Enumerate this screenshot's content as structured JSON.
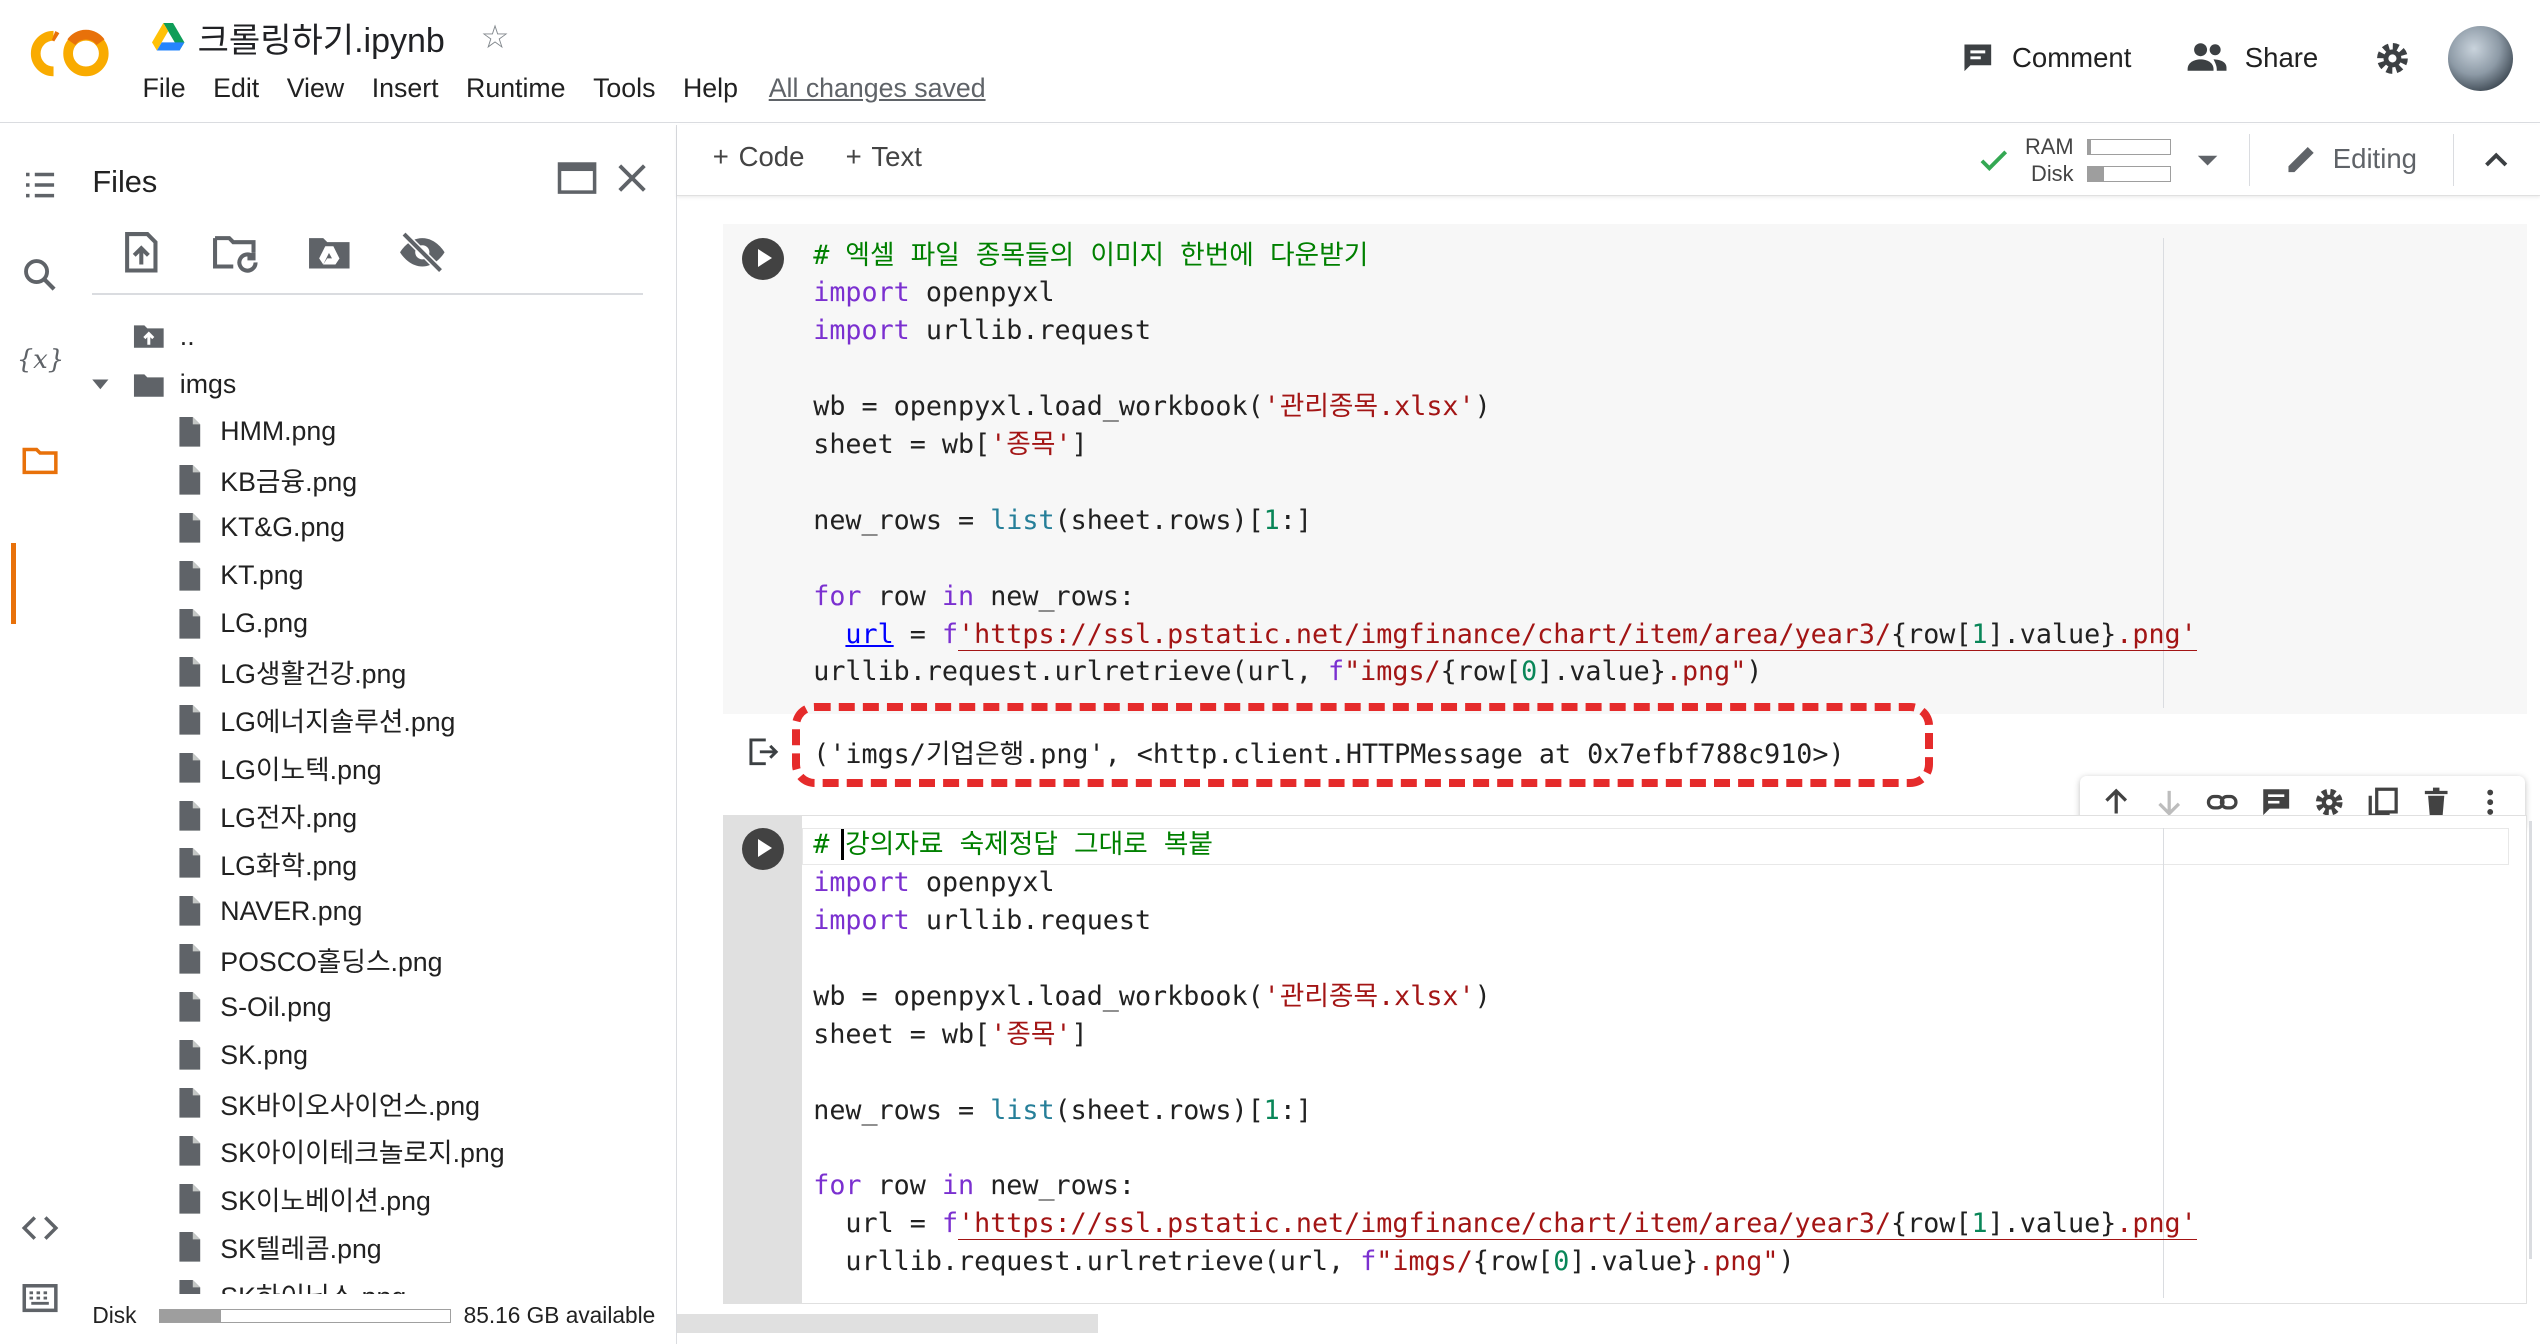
{
  "app": {
    "notebook_title": "크롤링하기.ipynb",
    "menu": [
      "File",
      "Edit",
      "View",
      "Insert",
      "Runtime",
      "Tools",
      "Help"
    ],
    "saved_status": "All changes saved",
    "comment_label": "Comment",
    "share_label": "Share"
  },
  "files_panel": {
    "title": "Files",
    "parent_dir": "..",
    "folder": "imgs",
    "files": [
      "HMM.png",
      "KB금융.png",
      "KT&G.png",
      "KT.png",
      "LG.png",
      "LG생활건강.png",
      "LG에너지솔루션.png",
      "LG이노텍.png",
      "LG전자.png",
      "LG화학.png",
      "NAVER.png",
      "POSCO홀딩스.png",
      "S-Oil.png",
      "SK.png",
      "SK바이오사이언스.png",
      "SK아이이테크놀로지.png",
      "SK이노베이션.png",
      "SK텔레콤.png",
      "SK하이닉스.png"
    ],
    "disk_label": "Disk",
    "disk_available": "85.16 GB available",
    "disk_used_fraction": 0.21
  },
  "toolbar": {
    "add_code": "Code",
    "add_text": "Text",
    "ram_label": "RAM",
    "disk_label": "Disk",
    "ram_used_fraction": 0.04,
    "disk_used_fraction": 0.2,
    "editing_label": "Editing"
  },
  "cell1": {
    "comment": "# 엑셀 파일 종목들의 이미지 한번에 다운받기",
    "output": "('imgs/기업은행.png', <http.client.HTTPMessage at 0x7efbf788c910>)"
  },
  "cell2": {
    "comment_hash": "#",
    "comment_text": "강의자료 숙제정답 그대로 복붙"
  },
  "code_tokens": {
    "import": "import",
    "openpyxl": "openpyxl",
    "urllib_request": "urllib.request",
    "wb_line_a": "wb = openpyxl.load_workbook(",
    "workbook_str": "'관리종목.xlsx'",
    "close_paren": ")",
    "sheet_line_a": "sheet = wb[",
    "sheet_str": "'종목'",
    "close_bracket": "]",
    "new_rows_a": "new_rows = ",
    "list_fn": "list",
    "new_rows_b": "(sheet.rows)[",
    "one": "1",
    "new_rows_c": ":]",
    "for_kw": "for",
    "row_var": " row ",
    "in_kw": "in",
    "new_rows_end": " new_rows:",
    "url_var": "url",
    "eq": " = ",
    "f_prefix": "f",
    "url_str_a": "'https://ssl.pstatic.net/imgfinance/chart/item/area/year3/",
    "row_open": "{row[",
    "row1_close": "].value}",
    "png_quote": ".png'",
    "retrieve_a": "urllib.request.urlretrieve(url, ",
    "imgs_str": "\"imgs/",
    "zero": "0",
    "png_dq": ".png\"",
    "indent": "  "
  }
}
